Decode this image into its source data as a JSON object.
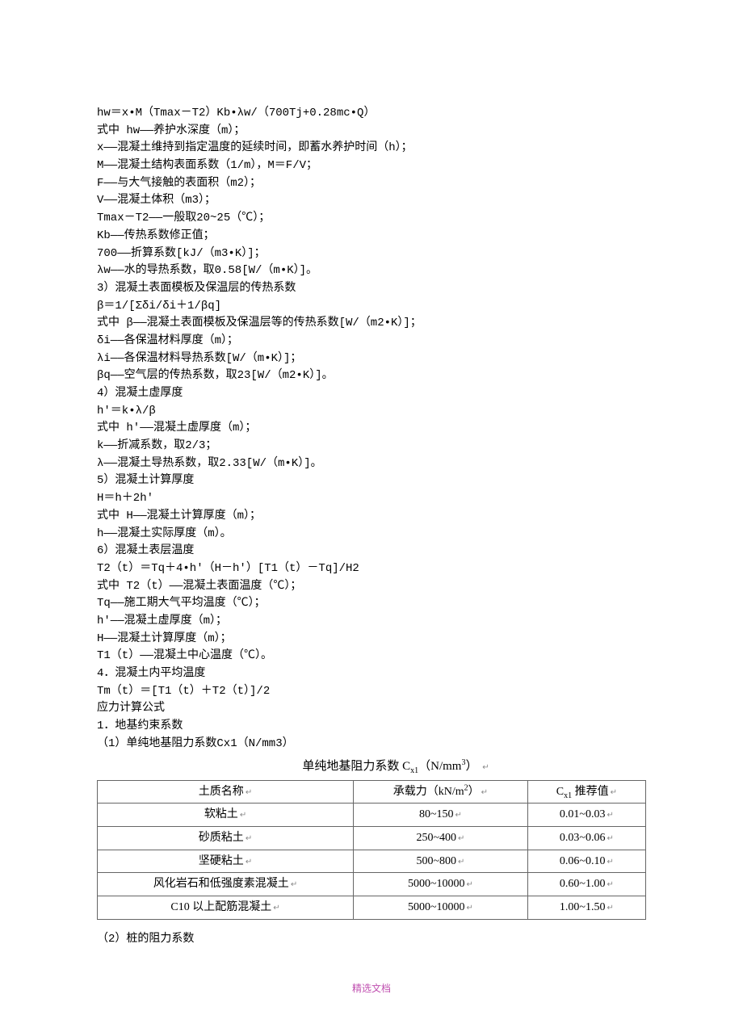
{
  "lines": [
    "hw＝x•M（Tmax－T2）Kb•λw/（700Tj+0.28mc•Q）",
    "式中 hw——养护水深度（m）；",
    "x——混凝土维持到指定温度的延续时间，即蓄水养护时间（h）；",
    "M——混凝土结构表面系数（1/m），M＝F/V；",
    "F——与大气接触的表面积（m2）；",
    "V——混凝土体积（m3）；",
    "Tmax－T2——一般取20~25（℃）；",
    "Kb——传热系数修正值；",
    "700——折算系数[kJ/（m3•K）]；",
    "λw——水的导热系数，取0.58[W/（m•K）]。",
    "3）混凝土表面模板及保温层的传热系数",
    "β＝1/[Σδi/δi＋1/βq]",
    "式中 β——混凝土表面模板及保温层等的传热系数[W/（m2•K）]；",
    "δi——各保温材料厚度（m）；",
    "λi——各保温材料导热系数[W/（m•K）]；",
    "βq——空气层的传热系数，取23[W/（m2•K）]。",
    "4）混凝土虚厚度",
    "h'＝k•λ/β",
    "式中 h'——混凝土虚厚度（m）；",
    "k——折减系数，取2/3；",
    "λ——混凝土导热系数，取2.33[W/（m•K）]。",
    "5）混凝土计算厚度",
    "H＝h＋2h'",
    "式中 H——混凝土计算厚度（m）；",
    "h——混凝土实际厚度（m）。",
    "6）混凝土表层温度",
    "T2（t）＝Tq＋4•h'（H－h'）[T1（t）－Tq]/H2",
    "式中 T2（t）——混凝土表面温度（℃）；",
    "Tq——施工期大气平均温度（℃）；",
    "h'——混凝土虚厚度（m）；",
    "H——混凝土计算厚度（m）；",
    "T1（t）——混凝土中心温度（℃）。",
    "4．混凝土内平均温度",
    "Tm（t）＝[T1（t）＋T2（t）]/2",
    "应力计算公式",
    "1．地基约束系数",
    "（1）单纯地基阻力系数Cx1（N/mm3）"
  ],
  "table": {
    "title_prefix": "单纯地基阻力系数 C",
    "title_sub": "x1",
    "title_unit": "（N/mm",
    "title_sup": "3",
    "title_close": "）",
    "headers": [
      "土质名称",
      "承载力（kN/m",
      "2",
      "）",
      "C",
      "x1",
      " 推荐值"
    ],
    "rows": [
      {
        "name": "软粘土",
        "bearing": "80~150",
        "cx1": "0.01~0.03"
      },
      {
        "name": "砂质粘土",
        "bearing": "250~400",
        "cx1": "0.03~0.06"
      },
      {
        "name": "坚硬粘土",
        "bearing": "500~800",
        "cx1": "0.06~0.10"
      },
      {
        "name": "风化岩石和低强度素混凝土",
        "bearing": "5000~10000",
        "cx1": "0.60~1.00"
      },
      {
        "name": "C10 以上配筋混凝土",
        "bearing": "5000~10000",
        "cx1": "1.00~1.50"
      }
    ]
  },
  "after_table": "（2）桩的阻力系数",
  "footer": "精选文档",
  "ret": "↵"
}
